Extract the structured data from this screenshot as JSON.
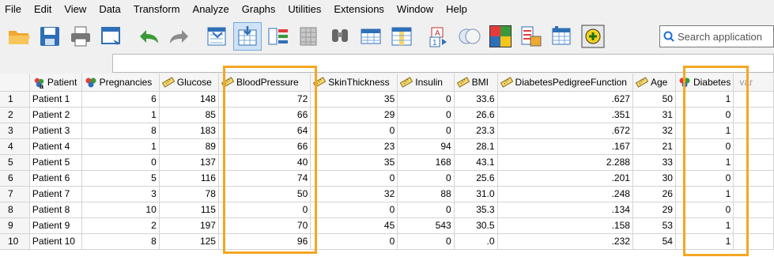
{
  "menu": [
    "File",
    "Edit",
    "View",
    "Data",
    "Transform",
    "Analyze",
    "Graphs",
    "Utilities",
    "Extensions",
    "Window",
    "Help"
  ],
  "toolbar": {
    "icons": [
      "open-folder-icon",
      "save-icon",
      "print-icon",
      "dialog-recall-icon",
      "undo-icon",
      "redo-icon",
      "goto-case-icon",
      "goto-variable-icon",
      "variables-icon",
      "run-descriptives-icon",
      "find-icon",
      "insert-cases-icon",
      "insert-variable-icon",
      "split-file-icon",
      "weight-cases-icon",
      "select-cases-icon",
      "value-labels-icon",
      "use-variable-sets-icon",
      "show-all-variables-icon",
      "spelling-icon"
    ],
    "search_placeholder": "Search application"
  },
  "columns": [
    {
      "label": "Patient",
      "type": "string"
    },
    {
      "label": "Pregnancies",
      "type": "nominal"
    },
    {
      "label": "Glucose",
      "type": "scale"
    },
    {
      "label": "BloodPressure",
      "type": "scale"
    },
    {
      "label": "SkinThickness",
      "type": "scale"
    },
    {
      "label": "Insulin",
      "type": "scale"
    },
    {
      "label": "BMI",
      "type": "scale"
    },
    {
      "label": "DiabetesPedigreeFunction",
      "type": "scale"
    },
    {
      "label": "Age",
      "type": "scale"
    },
    {
      "label": "Diabetes",
      "type": "nominal"
    },
    {
      "label": "var",
      "type": "empty"
    }
  ],
  "rows": [
    [
      "1",
      "Patient 1",
      "6",
      "148",
      "72",
      "35",
      "0",
      "33.6",
      ".627",
      "50",
      "1"
    ],
    [
      "2",
      "Patient 2",
      "1",
      "85",
      "66",
      "29",
      "0",
      "26.6",
      ".351",
      "31",
      "0"
    ],
    [
      "3",
      "Patient 3",
      "8",
      "183",
      "64",
      "0",
      "0",
      "23.3",
      ".672",
      "32",
      "1"
    ],
    [
      "4",
      "Patient 4",
      "1",
      "89",
      "66",
      "23",
      "94",
      "28.1",
      ".167",
      "21",
      "0"
    ],
    [
      "5",
      "Patient 5",
      "0",
      "137",
      "40",
      "35",
      "168",
      "43.1",
      "2.288",
      "33",
      "1"
    ],
    [
      "6",
      "Patient 6",
      "5",
      "116",
      "74",
      "0",
      "0",
      "25.6",
      ".201",
      "30",
      "0"
    ],
    [
      "7",
      "Patient 7",
      "3",
      "78",
      "50",
      "32",
      "88",
      "31.0",
      ".248",
      "26",
      "1"
    ],
    [
      "8",
      "Patient 8",
      "10",
      "115",
      "0",
      "0",
      "0",
      "35.3",
      ".134",
      "29",
      "0"
    ],
    [
      "9",
      "Patient 9",
      "2",
      "197",
      "70",
      "45",
      "543",
      "30.5",
      ".158",
      "53",
      "1"
    ],
    [
      "10",
      "Patient 10",
      "8",
      "125",
      "96",
      "0",
      "0",
      ".0",
      ".232",
      "54",
      "1"
    ]
  ],
  "colors": {
    "highlight": "#f5a623",
    "selected_tool": "#cfe2f6"
  }
}
